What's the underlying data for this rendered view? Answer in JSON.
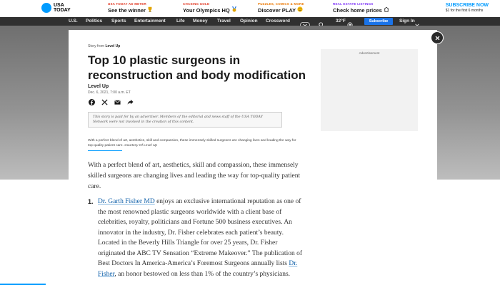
{
  "promo": {
    "logo": "USA TODAY",
    "items": [
      {
        "kicker": "USA TODAY AD METER",
        "title": "See the winner",
        "icon": "trophy-icon",
        "color": "#e0341f"
      },
      {
        "kicker": "CHASING GOLD",
        "title": "Your Olympics HQ",
        "icon": "medal-icon",
        "color": "#e0341f"
      },
      {
        "kicker": "PUZZLES, COMICS & MORE",
        "title": "Discover PLAY",
        "icon": "smiley-icon",
        "color": "#ea7600"
      },
      {
        "kicker": "REAL ESTATE LISTINGS",
        "title": "Check home prices",
        "icon": "house-icon",
        "color": "#7b2ff7"
      }
    ],
    "subscribe_now": "SUBSCRIBE NOW",
    "offer": "$1 for the first 6 months"
  },
  "nav": {
    "items": [
      "U.S.",
      "Politics",
      "Sports",
      "Entertainment",
      "Life",
      "Money",
      "Travel",
      "Opinion",
      "Crossword"
    ],
    "weather": "32°F",
    "subscribe": "Subscribe",
    "sign_in": "Sign In"
  },
  "article": {
    "story_from_label": "Story from",
    "story_from_source": "Level Up",
    "headline": "Top 10 plastic surgeons in reconstruction and body modification",
    "author": "Level Up",
    "date": "Dec. 6, 2021, 7:00 a.m. ET",
    "disclaimer": "This story is paid for by an advertiser. Members of the editorial and news staff of the USA TODAY Network were not involved in the creation of this content.",
    "caption": "With a perfect blend of art, aesthetics, skill and compassion, these immensely skilled surgeons are changing lives and leading the way for top-quality patient care.",
    "caption_credit": "Courtesy Of Level Up",
    "intro": "With a perfect blend of art, aesthetics, skill and compassion, these immensely skilled surgeons are changing lives and leading the way for top-quality patient care.",
    "list_number": "1.",
    "list_link": "Dr. Garth Fisher MD",
    "list_text_1": "enjoys an exclusive international reputation as one of the most renowned plastic surgeons worldwide with a client base of celebrities, royalty, politicians and Fortune 500 business executives. An innovator in the industry, Dr. Fisher celebrates each patient’s beauty. Located in the Beverly Hills Triangle for over 25 years, Dr. Fisher originated the ABC TV Sensation “Extreme Makeover.” The publication of Best Doctors In America-America’s Foremost Surgeons annually lists",
    "list_link_2": "Dr. Fisher",
    "list_text_2": ", an honor bestowed on less than 1% of the country’s physicians."
  },
  "ad": {
    "label": "Advertisement"
  },
  "colors": {
    "brand": "#009bff",
    "nav_bg": "#303030",
    "subscribe_btn": "#1a73e8"
  }
}
